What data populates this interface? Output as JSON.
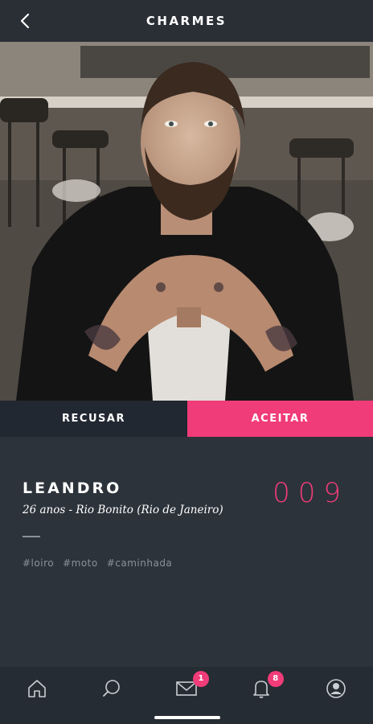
{
  "header": {
    "title": "CHARMES",
    "back_icon": "chevron-left-icon"
  },
  "photo": {
    "subject": "profile-photo"
  },
  "actions": {
    "decline_label": "RECUSAR",
    "accept_label": "ACEITAR"
  },
  "profile": {
    "name": "LEANDRO",
    "details": "26 anos - Rio Bonito (Rio de Janeiro)",
    "counter": "009",
    "tags": [
      "#loiro",
      "#moto",
      "#caminhada"
    ]
  },
  "nav": {
    "items": [
      {
        "icon": "home-icon",
        "badge": ""
      },
      {
        "icon": "search-icon",
        "badge": ""
      },
      {
        "icon": "mail-icon",
        "badge": "1"
      },
      {
        "icon": "bell-icon",
        "badge": "8"
      },
      {
        "icon": "profile-icon",
        "badge": ""
      }
    ]
  },
  "colors": {
    "accent": "#f03c78",
    "background": "#2d333b",
    "header": "#2a2f36",
    "decline": "#222831"
  }
}
